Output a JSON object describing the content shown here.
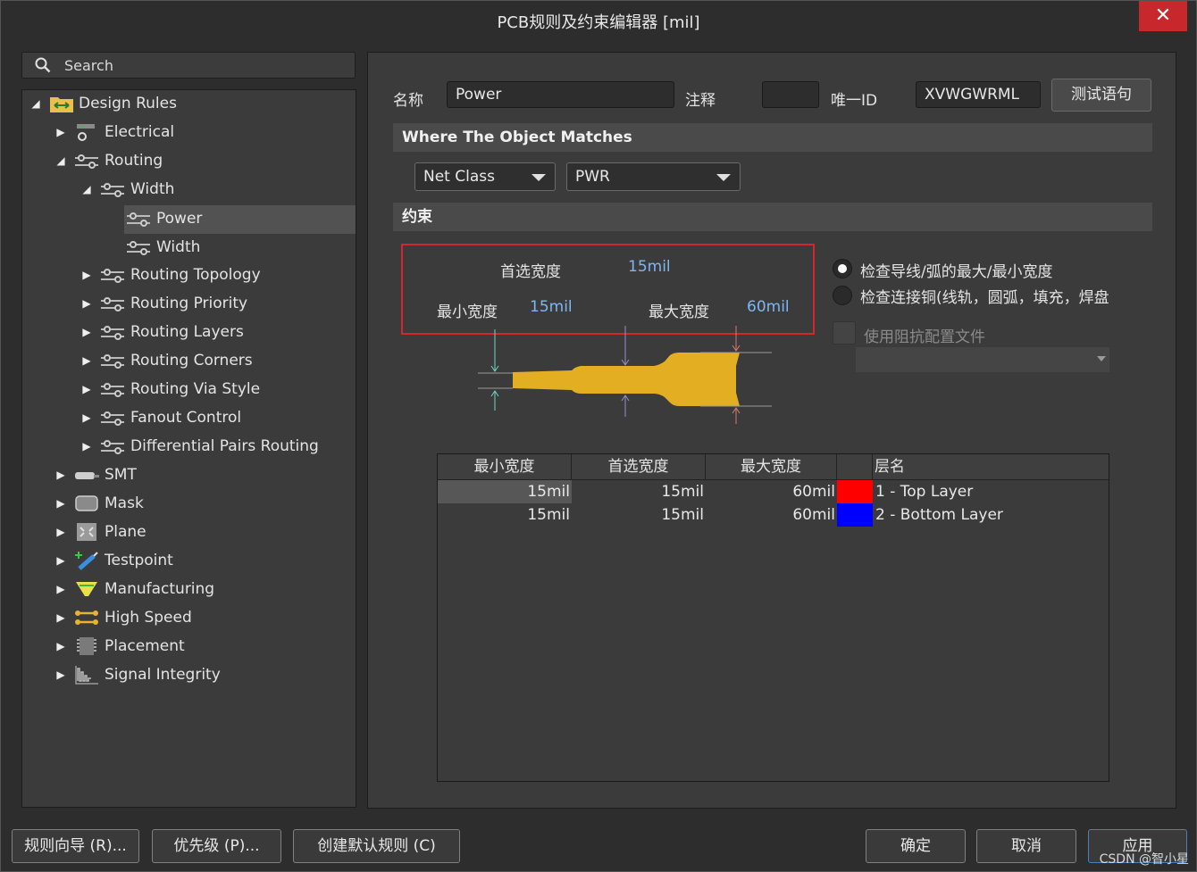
{
  "window": {
    "title": "PCB规则及约束编辑器 [mil]",
    "close": "✕"
  },
  "search": {
    "placeholder": "Search"
  },
  "tree": {
    "root": "Design Rules",
    "electrical": "Electrical",
    "routing": "Routing",
    "width": "Width",
    "power": "Power",
    "width_rule": "Width",
    "routing_topology": "Routing Topology",
    "routing_priority": "Routing Priority",
    "routing_layers": "Routing Layers",
    "routing_corners": "Routing Corners",
    "routing_via_style": "Routing Via Style",
    "fanout_control": "Fanout Control",
    "diff_pairs": "Differential Pairs Routing",
    "smt": "SMT",
    "mask": "Mask",
    "plane": "Plane",
    "testpoint": "Testpoint",
    "manufacturing": "Manufacturing",
    "high_speed": "High Speed",
    "placement": "Placement",
    "signal_integrity": "Signal Integrity"
  },
  "rule": {
    "name_label": "名称",
    "name_value": "Power",
    "comment_label": "注释",
    "comment_value": "",
    "uid_label": "唯一ID",
    "uid_value": "XVWGWRML",
    "test_button": "测试语句"
  },
  "match": {
    "header": "Where The Object Matches",
    "type": "Net Class",
    "value": "PWR"
  },
  "constraints": {
    "header": "约束",
    "preferred_label": "首选宽度",
    "preferred_value": "15mil",
    "min_label": "最小宽度",
    "min_value": "15mil",
    "max_label": "最大宽度",
    "max_value": "60mil",
    "radio1": "检查导线/弧的最大/最小宽度",
    "radio2": "检查连接铜(线轨，圆弧，填充，焊盘",
    "impedance": "使用阻抗配置文件",
    "trace_color": "#e3ae22"
  },
  "table": {
    "headers": [
      "最小宽度",
      "首选宽度",
      "最大宽度",
      "层名"
    ],
    "rows": [
      {
        "min": "15mil",
        "pref": "15mil",
        "max": "60mil",
        "color": "#ff0000",
        "layer": "1 - Top Layer"
      },
      {
        "min": "15mil",
        "pref": "15mil",
        "max": "60mil",
        "color": "#0000ff",
        "layer": "2 - Bottom Layer"
      }
    ]
  },
  "footer": {
    "wizard": "规则向导 (R)...",
    "priority": "优先级 (P)...",
    "create_default": "创建默认规则 (C)",
    "ok": "确定",
    "cancel": "取消",
    "apply": "应用"
  },
  "watermark": "CSDN @智小星"
}
